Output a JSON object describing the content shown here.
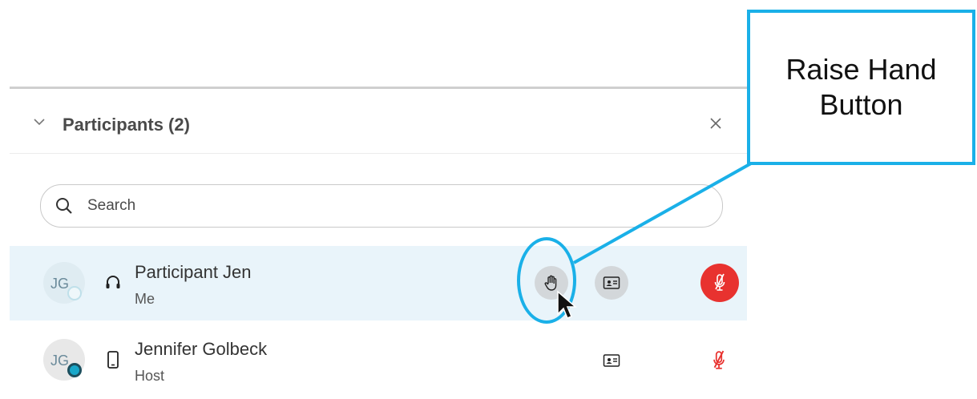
{
  "panel": {
    "title": "Participants (2)",
    "search": {
      "placeholder": "Search",
      "value": ""
    }
  },
  "participants": [
    {
      "initials": "JG",
      "name": "Participant Jen",
      "role": "Me",
      "device": "headset-icon",
      "presence": "away",
      "status": "muted"
    },
    {
      "initials": "JG",
      "name": "Jennifer Golbeck",
      "role": "Host",
      "device": "phone-icon",
      "presence": "active",
      "status": "muted"
    }
  ],
  "callout": {
    "line1": "Raise Hand",
    "line2": "Button"
  },
  "colors": {
    "accent": "#1ab0e8",
    "mute_red": "#e8322f",
    "row_highlight": "#e9f4fa",
    "button_gray": "#d3d7da"
  }
}
